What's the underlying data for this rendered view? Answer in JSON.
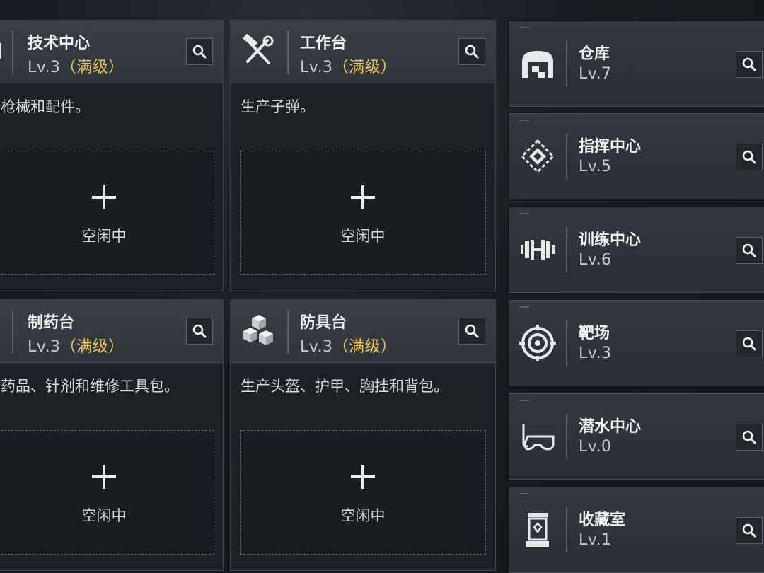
{
  "facilities": [
    {
      "name": "技术中心",
      "level": "Lv.3",
      "maxed": "（满级）",
      "desc": "枪械和配件。",
      "slot_label": "空闲中",
      "icon": "tech-center-icon"
    },
    {
      "name": "工作台",
      "level": "Lv.3",
      "maxed": "（满级）",
      "desc": "生产子弹。",
      "slot_label": "空闲中",
      "icon": "hammer-wrench-icon"
    },
    {
      "name": "制药台",
      "level": "Lv.3",
      "maxed": "（满级）",
      "desc": "药品、针剂和维修工具包。",
      "slot_label": "空闲中",
      "icon": "pharmacy-icon"
    },
    {
      "name": "防具台",
      "level": "Lv.3",
      "maxed": "（满级）",
      "desc": "生产头盔、护甲、胸挂和背包。",
      "slot_label": "空闲中",
      "icon": "armor-cubes-icon"
    }
  ],
  "side_facilities": [
    {
      "name": "仓库",
      "level": "Lv.7",
      "icon": "warehouse-icon"
    },
    {
      "name": "指挥中心",
      "level": "Lv.5",
      "icon": "command-chip-icon"
    },
    {
      "name": "训练中心",
      "level": "Lv.6",
      "icon": "dumbbell-icon"
    },
    {
      "name": "靶场",
      "level": "Lv.3",
      "icon": "target-icon"
    },
    {
      "name": "潜水中心",
      "level": "Lv.0",
      "icon": "diving-mask-icon"
    },
    {
      "name": "收藏室",
      "level": "Lv.1",
      "icon": "display-case-icon"
    }
  ],
  "colors": {
    "maxed_accent": "#e7c35a",
    "card_bg": "#1d2126",
    "header_bg": "#33383e"
  }
}
